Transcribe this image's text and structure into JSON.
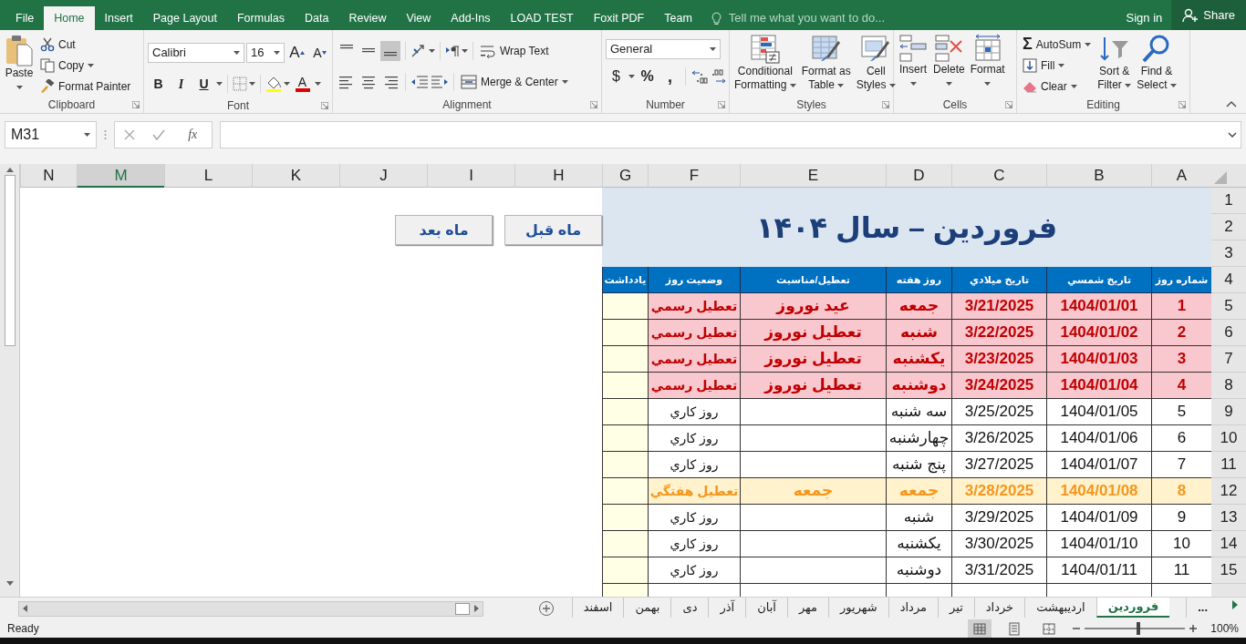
{
  "menu_tabs": {
    "file": {
      "label": "File",
      "selected": false
    },
    "home": {
      "label": "Home",
      "selected": true
    },
    "insert": {
      "label": "Insert",
      "selected": false
    },
    "page_layout": {
      "label": "Page Layout",
      "selected": false
    },
    "formulas": {
      "label": "Formulas",
      "selected": false
    },
    "data": {
      "label": "Data",
      "selected": false
    },
    "review": {
      "label": "Review",
      "selected": false
    },
    "view": {
      "label": "View",
      "selected": false
    },
    "add_ins": {
      "label": "Add-Ins",
      "selected": false
    },
    "load_test": {
      "label": "LOAD TEST",
      "selected": false
    },
    "foxit_pdf": {
      "label": "Foxit PDF",
      "selected": false
    },
    "team": {
      "label": "Team",
      "selected": false
    }
  },
  "tell_me": {
    "placeholder": "Tell me what you want to do..."
  },
  "sign_in": "Sign in",
  "share": "Share",
  "clipboard": {
    "label": "Clipboard",
    "paste": "Paste",
    "cut": "Cut",
    "copy": "Copy",
    "format_painter": "Format Painter"
  },
  "font": {
    "label": "Font",
    "font_name": "Calibri",
    "font_size": "16",
    "grow": "A",
    "shrink": "A",
    "bold": "B",
    "italic": "I",
    "underline": "U",
    "font_color": "A"
  },
  "alignment": {
    "label": "Alignment",
    "vertical_align": [
      {
        "selected": false
      },
      {
        "selected": false
      },
      {
        "selected": true
      }
    ],
    "wrap_text": "Wrap Text",
    "merge_center": "Merge & Center"
  },
  "number": {
    "label": "Number",
    "format": "General",
    "currency": "$",
    "percent": "%",
    "comma": ","
  },
  "styles": {
    "label": "Styles",
    "conditional_formatting": [
      "Conditional",
      "Formatting"
    ],
    "format_as_table": [
      "Format as",
      "Table"
    ],
    "cell_styles": [
      "Cell",
      "Styles"
    ]
  },
  "cells": {
    "label": "Cells",
    "insert": "Insert",
    "delete": "Delete",
    "format": "Format"
  },
  "editing": {
    "label": "Editing",
    "sigma": "Σ",
    "autosum": "AutoSum",
    "fill": "Fill",
    "clear": "Clear",
    "sort_filter": [
      "Sort &",
      "Filter"
    ],
    "find_select": [
      "Find &",
      "Select"
    ]
  },
  "formula_bar": {
    "name_box": "M31",
    "fx": "fx"
  },
  "sheet": {
    "columns": [
      {
        "label": "A",
        "selected": false
      },
      {
        "label": "B",
        "selected": false
      },
      {
        "label": "C",
        "selected": false
      },
      {
        "label": "D",
        "selected": false
      },
      {
        "label": "E",
        "selected": false
      },
      {
        "label": "F",
        "selected": false
      },
      {
        "label": "G",
        "selected": false
      },
      {
        "label": "H",
        "selected": false
      },
      {
        "label": "I",
        "selected": false
      },
      {
        "label": "J",
        "selected": false
      },
      {
        "label": "K",
        "selected": false
      },
      {
        "label": "L",
        "selected": false
      },
      {
        "label": "M",
        "selected": true
      },
      {
        "label": "N",
        "selected": false
      }
    ],
    "rows": [
      "1",
      "2",
      "3",
      "4",
      "5",
      "6",
      "7",
      "8",
      "9",
      "10",
      "11",
      "12",
      "13",
      "14",
      "15"
    ],
    "title": "فروردین – سال ۱۴۰۴",
    "buttons": [
      "ماه قبل",
      "ماه بعد"
    ],
    "table": {
      "columns": [
        "شماره روز",
        "تاریخ شمسي",
        "تاریخ میلادي",
        "روز هفته",
        "تعطیل/مناسبت",
        "وضعیت روز",
        "یادداشت"
      ],
      "rows": [
        {
          "kind": "holiday",
          "cells": [
            "1",
            "1404/01/01",
            "3/21/2025",
            "جمعه",
            "عید نوروز",
            "تعطیل رسمي"
          ]
        },
        {
          "kind": "holiday",
          "cells": [
            "2",
            "1404/01/02",
            "3/22/2025",
            "شنبه",
            "تعطیل نوروز",
            "تعطیل رسمي"
          ]
        },
        {
          "kind": "holiday",
          "cells": [
            "3",
            "1404/01/03",
            "3/23/2025",
            "یکشنبه",
            "تعطیل نوروز",
            "تعطیل رسمي"
          ]
        },
        {
          "kind": "holiday",
          "cells": [
            "4",
            "1404/01/04",
            "3/24/2025",
            "دوشنبه",
            "تعطیل نوروز",
            "تعطیل رسمي"
          ]
        },
        {
          "kind": "workday",
          "cells": [
            "5",
            "1404/01/05",
            "3/25/2025",
            "سه شنبه",
            "",
            "روز كاري"
          ]
        },
        {
          "kind": "workday",
          "cells": [
            "6",
            "1404/01/06",
            "3/26/2025",
            "چهارشنبه",
            "",
            "روز كاري"
          ]
        },
        {
          "kind": "workday",
          "cells": [
            "7",
            "1404/01/07",
            "3/27/2025",
            "پنج شنبه",
            "",
            "روز كاري"
          ]
        },
        {
          "kind": "weekend",
          "cells": [
            "8",
            "1404/01/08",
            "3/28/2025",
            "جمعه",
            "جمعه",
            "تعطیل هفتگي"
          ]
        },
        {
          "kind": "workday",
          "cells": [
            "9",
            "1404/01/09",
            "3/29/2025",
            "شنبه",
            "",
            "روز كاري"
          ]
        },
        {
          "kind": "workday",
          "cells": [
            "10",
            "1404/01/10",
            "3/30/2025",
            "یکشنبه",
            "",
            "روز كاري"
          ]
        },
        {
          "kind": "workday",
          "cells": [
            "11",
            "1404/01/11",
            "3/31/2025",
            "دوشنبه",
            "",
            "روز كاري"
          ]
        }
      ]
    }
  },
  "sheet_tabs": [
    {
      "label": "فروردین",
      "selected": true
    },
    {
      "label": "اردیبهشت",
      "selected": false
    },
    {
      "label": "خرداد",
      "selected": false
    },
    {
      "label": "تیر",
      "selected": false
    },
    {
      "label": "مرداد",
      "selected": false
    },
    {
      "label": "شهریور",
      "selected": false
    },
    {
      "label": "مهر",
      "selected": false
    },
    {
      "label": "آبان",
      "selected": false
    },
    {
      "label": "آذر",
      "selected": false
    },
    {
      "label": "دی",
      "selected": false
    },
    {
      "label": "بهمن",
      "selected": false
    },
    {
      "label": "اسفند",
      "selected": false
    }
  ],
  "tabs_overflow": "...",
  "status_bar": {
    "text": "Ready",
    "views": [
      {
        "selected": true
      },
      {
        "selected": false
      },
      {
        "selected": false
      }
    ],
    "zoom": {
      "level": 0.52
    },
    "zoom_text": "100%"
  }
}
